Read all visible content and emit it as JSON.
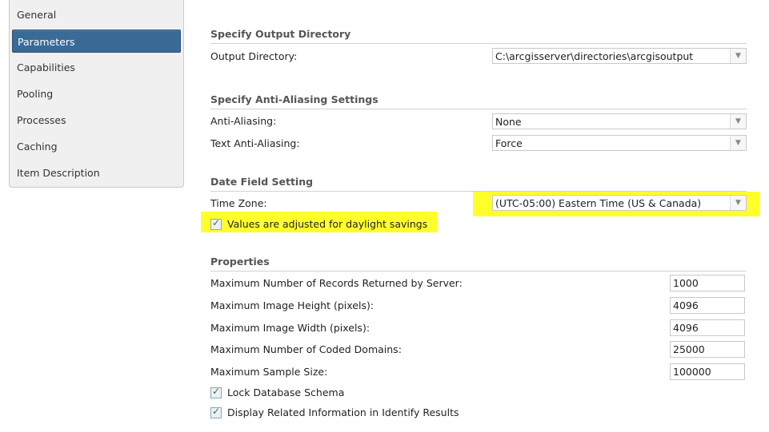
{
  "sidebar": {
    "items": [
      {
        "label": "General"
      },
      {
        "label": "Parameters"
      },
      {
        "label": "Capabilities"
      },
      {
        "label": "Pooling"
      },
      {
        "label": "Processes"
      },
      {
        "label": "Caching"
      },
      {
        "label": "Item Description"
      }
    ],
    "active": "Parameters"
  },
  "output": {
    "title": "Specify Output Directory",
    "directory_label": "Output Directory:",
    "directory_value": "C:\\arcgisserver\\directories\\arcgisoutput"
  },
  "antialias": {
    "title": "Specify Anti-Aliasing Settings",
    "aa_label": "Anti-Aliasing:",
    "aa_value": "None",
    "text_label": "Text Anti-Aliasing:",
    "text_value": "Force"
  },
  "date": {
    "title": "Date Field Setting",
    "tz_label": "Time Zone:",
    "tz_value": "(UTC-05:00) Eastern Time (US & Canada)",
    "dst_label": "Values are adjusted for daylight savings",
    "dst_checked": true,
    "highlight_color": "#ffff2a"
  },
  "properties": {
    "title": "Properties",
    "max_records_label": "Maximum Number of Records Returned by Server:",
    "max_records_value": "1000",
    "max_height_label": "Maximum Image Height (pixels):",
    "max_height_value": "4096",
    "max_width_label": "Maximum Image Width (pixels):",
    "max_width_value": "4096",
    "max_domains_label": "Maximum Number of Coded Domains:",
    "max_domains_value": "25000",
    "max_sample_label": "Maximum Sample Size:",
    "max_sample_value": "100000",
    "lock_schema_label": "Lock Database Schema",
    "lock_schema_checked": true,
    "related_info_label": "Display Related Information in Identify Results",
    "related_info_checked": true
  },
  "colors": {
    "sidebar_active": "#3a6a96",
    "section_title": "#555555"
  }
}
